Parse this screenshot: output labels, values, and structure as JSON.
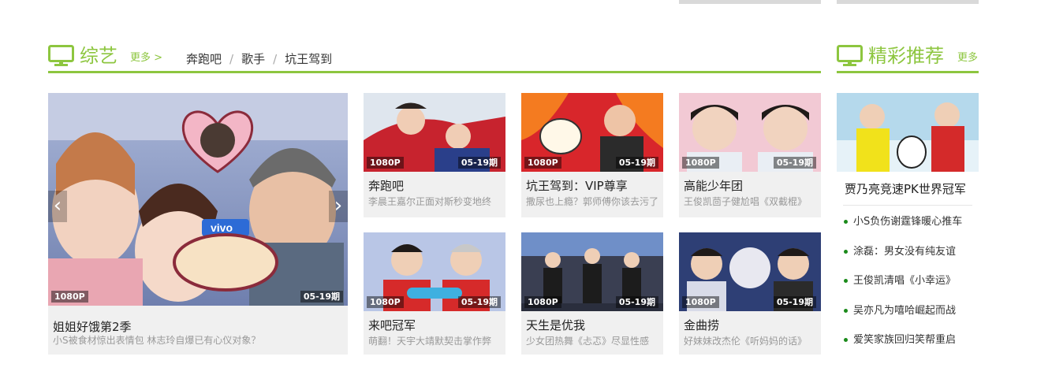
{
  "colors": {
    "accent": "#8dc63f",
    "text": "#333333",
    "muted": "#999999"
  },
  "variety": {
    "icon": "tv-icon",
    "title": "综艺",
    "more": "更多 >",
    "tags": [
      "奔跑吧",
      "歌手",
      "坑王驾到"
    ]
  },
  "featured": {
    "quality": "1080P",
    "episode": "05-19期",
    "title": "姐姐好饿第2季",
    "desc": "小S被食材惊出表情包 林志玲自爆已有心仪对象？",
    "prev_icon": "‹",
    "next_icon": "›"
  },
  "cards": [
    {
      "quality": "1080P",
      "episode": "05-19期",
      "title": "奔跑吧",
      "desc": "李晨王嘉尔正面对斯秒变地终"
    },
    {
      "quality": "1080P",
      "episode": "05-19期",
      "title": "坑王驾到：VIP尊享",
      "desc": "撒尿也上瘾？郭师傅你该去污了"
    },
    {
      "quality": "1080P",
      "episode": "05-19期",
      "title": "高能少年团",
      "desc": "王俊凯茴子健尬唱《双截棍》"
    },
    {
      "quality": "1080P",
      "episode": "05-19期",
      "title": "来吧冠军",
      "desc": "萌翻！天宇大靖默契击掌作弊"
    },
    {
      "quality": "1080P",
      "episode": "05-19期",
      "title": "天生是优我",
      "desc": "少女团热舞《忐忑》尽显性感"
    },
    {
      "quality": "1080P",
      "episode": "05-19期",
      "title": "金曲捞",
      "desc": "好妹妹改杰伦《听妈妈的话》"
    }
  ],
  "recommend": {
    "icon": "tv-icon",
    "title": "精彩推荐",
    "more": "更多",
    "top_title": "贾乃亮竞速PK世界冠军",
    "items": [
      "小S负伤谢霆锋暖心推车",
      "涂磊：男女没有纯友谊",
      "王俊凯清唱《小幸运》",
      "吴亦凡为嘻哈崛起而战",
      "爱笑家族回归笑帮重启"
    ]
  }
}
